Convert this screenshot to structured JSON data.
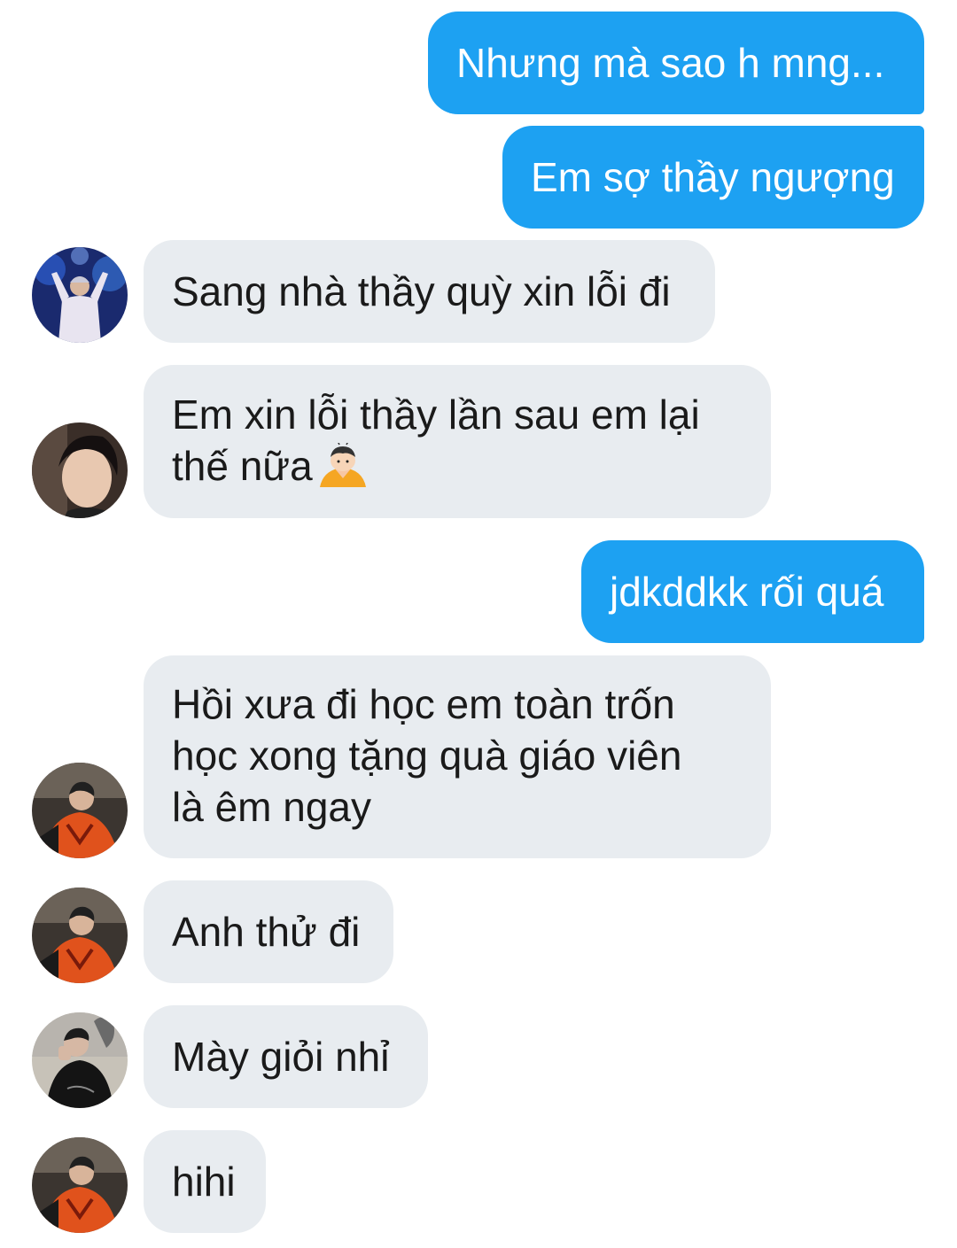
{
  "messages": [
    {
      "direction": "out",
      "text": "Nhưng mà sao h mng..."
    },
    {
      "direction": "out",
      "text": "Em sợ thầy ngượng"
    },
    {
      "direction": "in",
      "avatar": "avatar-concert-icon",
      "text": "Sang nhà thầy quỳ xin lỗi đi"
    },
    {
      "direction": "in",
      "avatar": "avatar-portrait-icon",
      "text_line1": "Em xin lỗi thầy lần sau em lại",
      "text_line2": "thế nữa",
      "emoji": "person-bowing-emoji-icon"
    },
    {
      "direction": "out",
      "text": "jdkddkk rối quá"
    },
    {
      "direction": "in",
      "avatar": "avatar-orange-shirt-icon",
      "text": "Hồi xưa đi học em toàn trốn\nhọc xong tặng quà giáo viên\nlà êm ngay"
    },
    {
      "direction": "in",
      "avatar": "avatar-orange-shirt-icon",
      "text": "Anh thử đi"
    },
    {
      "direction": "in",
      "avatar": "avatar-black-jacket-icon",
      "text": "Mày giỏi nhỉ"
    },
    {
      "direction": "in",
      "avatar": "avatar-orange-shirt-icon",
      "text": "hihi"
    }
  ],
  "colors": {
    "outgoing_bubble": "#1da1f2",
    "incoming_bubble": "#e8ecf0",
    "background": "#ffffff"
  }
}
